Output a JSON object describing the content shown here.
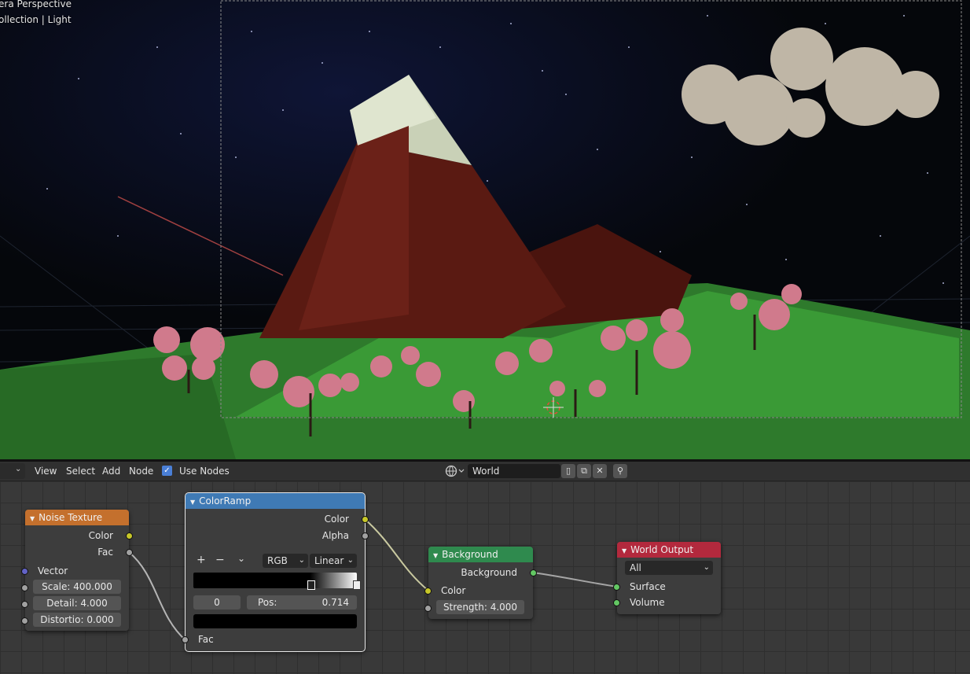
{
  "viewport": {
    "line1": "era Perspective",
    "line2": "ollection | Light"
  },
  "header": {
    "view": "View",
    "select": "Select",
    "add": "Add",
    "node": "Node",
    "use_nodes": "Use Nodes",
    "world_name": "World"
  },
  "nodes": {
    "noise": {
      "title": "Noise Texture",
      "out_color": "Color",
      "out_fac": "Fac",
      "in_vector": "Vector",
      "scale": "Scale:  400.000",
      "detail": "Detail:     4.000",
      "distortion": "Distortio:  0.000"
    },
    "colorramp": {
      "title": "ColorRamp",
      "out_color": "Color",
      "out_alpha": "Alpha",
      "plus": "+",
      "minus": "−",
      "more": "⌄",
      "mode": "RGB",
      "interp": "Linear",
      "index": "0",
      "pos_label": "Pos:",
      "pos_value": "0.714",
      "in_fac": "Fac"
    },
    "background": {
      "title": "Background",
      "out": "Background",
      "in_color": "Color",
      "strength": "Strength:  4.000"
    },
    "world_output": {
      "title": "World Output",
      "target": "All",
      "in_surface": "Surface",
      "in_volume": "Volume"
    }
  },
  "colors": {
    "noise_header": "#c4702d",
    "colorramp_header": "#3f7ab5",
    "background_header": "#2f8a4e",
    "output_header": "#b3293d"
  }
}
